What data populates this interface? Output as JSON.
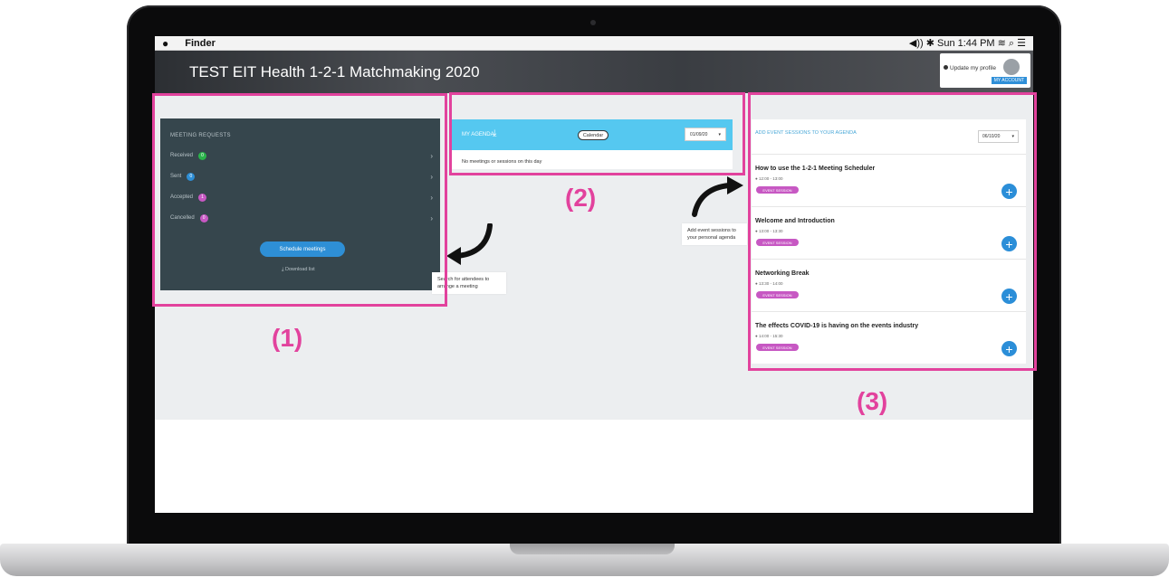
{
  "menubar": {
    "apple": "",
    "app_name": "Finder",
    "status": "◀︎)) ✱ Sun 1:44 PM ≋ ⌕ ☰"
  },
  "header": {
    "title": "TEST EIT Health 1-2-1 Matchmaking 2020",
    "profile_link": "Update my profile",
    "account_label": "MY ACCOUNT"
  },
  "meeting_requests": {
    "title": "MEETING REQUESTS",
    "rows": [
      {
        "label": "Received",
        "count": "0",
        "color": "#2ab44a"
      },
      {
        "label": "Sent",
        "count": "0",
        "color": "#2e8fd6"
      },
      {
        "label": "Accepted",
        "count": "1",
        "color": "#c758c3"
      },
      {
        "label": "Cancelled",
        "count": "0",
        "color": "#c758c3"
      }
    ],
    "schedule_button": "Schedule meetings",
    "download_link": "Download list"
  },
  "agenda": {
    "title": "MY AGENDA",
    "calendar_button": "Calendar",
    "date_select": "01/09/20",
    "empty_message": "No meetings or sessions on this day"
  },
  "event_sessions": {
    "title": "ADD EVENT SESSIONS TO YOUR AGENDA",
    "date_select": "06/10/20",
    "tag_label": "EVENT SESSION",
    "items": [
      {
        "title": "How to use the 1-2-1 Meeting Scheduler",
        "time": "12:00 - 13:00"
      },
      {
        "title": "Welcome and Introduction",
        "time": "13:00 - 13:30"
      },
      {
        "title": "Networking Break",
        "time": "13:30 - 14:00"
      },
      {
        "title": "The effects COVID-19 is having on the events industry",
        "time": "14:00 - 15:30"
      }
    ]
  },
  "tooltips": {
    "search_attendees": "Search for attendees to arrange a meeting",
    "add_sessions": "Add event sessions to your personal agenda"
  },
  "callouts": {
    "one": "(1)",
    "two": "(2)",
    "three": "(3)"
  },
  "colors": {
    "highlight": "#e2429d",
    "agenda_bar": "#55c8f0",
    "panel_dark": "#36464d",
    "primary_button": "#2e8fd6"
  }
}
